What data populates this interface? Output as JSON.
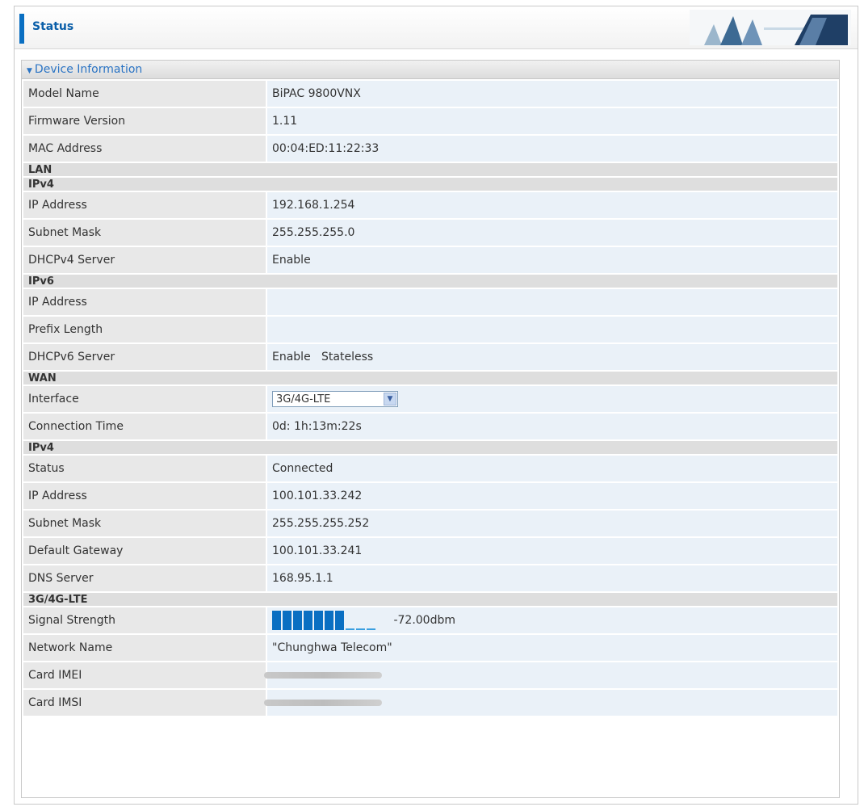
{
  "header": {
    "title": "Status"
  },
  "section": {
    "title": "Device Information"
  },
  "device": [
    {
      "label": "Model Name",
      "value": "BiPAC 9800VNX"
    },
    {
      "label": "Firmware Version",
      "value": "1.11"
    },
    {
      "label": "MAC Address",
      "value": "00:04:ED:11:22:33"
    }
  ],
  "lan": {
    "title": "LAN",
    "ipv4": {
      "title": "IPv4",
      "rows": [
        {
          "label": "IP Address",
          "value": "192.168.1.254"
        },
        {
          "label": "Subnet Mask",
          "value": "255.255.255.0"
        },
        {
          "label": "DHCPv4 Server",
          "value": "Enable"
        }
      ]
    },
    "ipv6": {
      "title": "IPv6",
      "rows": [
        {
          "label": "IP Address",
          "value": ""
        },
        {
          "label": "Prefix Length",
          "value": ""
        },
        {
          "label": "DHCPv6 Server",
          "value": "Enable   Stateless"
        }
      ]
    }
  },
  "wan": {
    "title": "WAN",
    "interface_label": "Interface",
    "interface_value": "3G/4G-LTE",
    "connection_time_label": "Connection Time",
    "connection_time_value": "0d: 1h:13m:22s",
    "ipv4": {
      "title": "IPv4",
      "rows": [
        {
          "label": "Status",
          "value": "Connected"
        },
        {
          "label": "IP Address",
          "value": "100.101.33.242"
        },
        {
          "label": "Subnet Mask",
          "value": "255.255.255.252"
        },
        {
          "label": "Default Gateway",
          "value": "100.101.33.241"
        },
        {
          "label": "DNS Server",
          "value": "168.95.1.1"
        }
      ]
    }
  },
  "lte": {
    "title": "3G/4G-LTE",
    "signal_label": "Signal Strength",
    "signal_bars_filled": 7,
    "signal_bars_total": 10,
    "signal_value": "-72.00dbm",
    "network_label": "Network Name",
    "network_value": "\"Chunghwa Telecom\"",
    "imei_label": "Card IMEI",
    "imsi_label": "Card IMSI"
  },
  "colors": {
    "accent": "#0a6fc2",
    "label_bg": "#e8e8e8",
    "value_bg": "#eaf1f8",
    "group_bg": "#dedede"
  },
  "icons": {
    "select_arrow": "chevron-down-icon",
    "section_toggle": "triangle-down-icon"
  }
}
